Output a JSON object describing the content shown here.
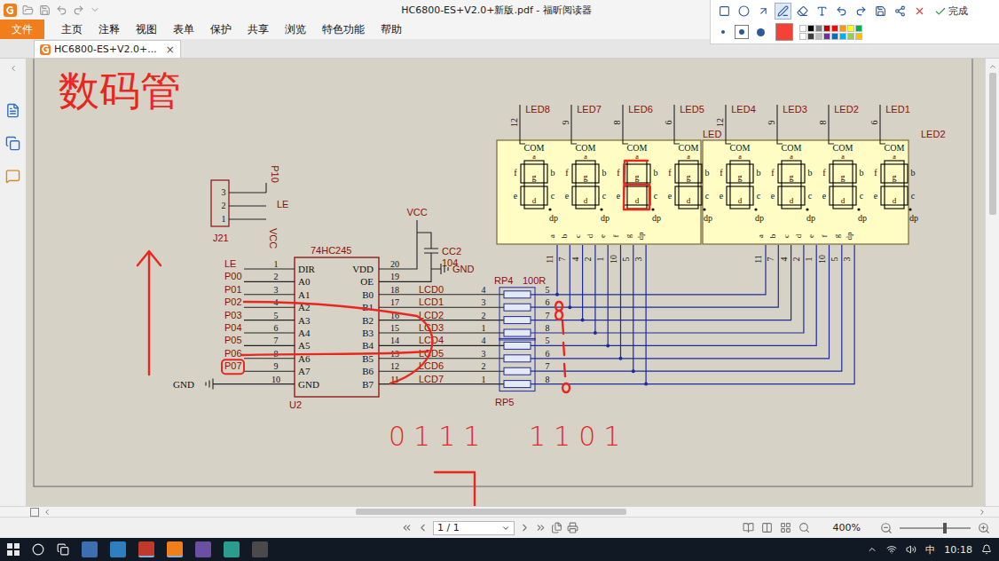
{
  "window": {
    "title": "HC6800-ES+V2.0+新版.pdf - 福昕阅读器"
  },
  "menu": [
    {
      "label": "文件",
      "selected": true
    },
    {
      "label": "主页",
      "selected": false
    },
    {
      "label": "注释",
      "selected": false
    },
    {
      "label": "视图",
      "selected": false
    },
    {
      "label": "表单",
      "selected": false
    },
    {
      "label": "保护",
      "selected": false
    },
    {
      "label": "共享",
      "selected": false
    },
    {
      "label": "浏览",
      "selected": false
    },
    {
      "label": "特色功能",
      "selected": false
    },
    {
      "label": "帮助",
      "selected": false
    }
  ],
  "tabs": [
    {
      "label": "HC6800-ES+V2.0+...",
      "selected": true,
      "close": "×"
    }
  ],
  "annotation_toolbar": {
    "tools": [
      {
        "kind": "rectangle",
        "selected": false
      },
      {
        "kind": "ellipse",
        "selected": false
      },
      {
        "kind": "arrow",
        "selected": false
      },
      {
        "kind": "pen",
        "selected": true
      },
      {
        "kind": "eraser",
        "selected": false
      },
      {
        "kind": "text",
        "selected": false
      },
      {
        "kind": "undo",
        "selected": false
      },
      {
        "kind": "redo",
        "selected": false
      },
      {
        "kind": "save",
        "selected": false
      },
      {
        "kind": "share",
        "selected": false
      },
      {
        "kind": "close",
        "selected": false
      }
    ],
    "done": "完成",
    "pen_sizes": [
      {
        "selected": false
      },
      {
        "selected": true
      },
      {
        "selected": false
      }
    ],
    "current_color": "#f44336",
    "palette": [
      {
        "color": "#ffffff",
        "selected": false
      },
      {
        "color": "#000000",
        "selected": false
      },
      {
        "color": "#7f7f7f",
        "selected": false
      },
      {
        "color": "#c00000",
        "selected": false
      },
      {
        "color": "#ff0000",
        "selected": false
      },
      {
        "color": "#ff9900",
        "selected": false
      },
      {
        "color": "#ffff00",
        "selected": false
      },
      {
        "color": "#00b050",
        "selected": false
      },
      {
        "color": "#ffffff",
        "selected": false
      },
      {
        "color": "#3f3f3f",
        "selected": false
      },
      {
        "color": "#bfbfbf",
        "selected": false
      },
      {
        "color": "#7030a0",
        "selected": false
      },
      {
        "color": "#0070c0",
        "selected": false
      },
      {
        "color": "#00b0f0",
        "selected": false
      },
      {
        "color": "#92d050",
        "selected": false
      },
      {
        "color": "#ffc000",
        "selected": false
      }
    ]
  },
  "schematic": {
    "heading": "数码管",
    "connector": {
      "ref": "J21",
      "pins": [
        {
          "num": "3",
          "net": "P10"
        },
        {
          "num": "2",
          "net": "LE"
        },
        {
          "num": "1",
          "net": "VCC"
        }
      ]
    },
    "chip": {
      "part": "74HC245",
      "ref": "U2",
      "left": [
        {
          "net": "LE",
          "num": "1",
          "name": "DIR",
          "kind": "signal",
          "marked": false
        },
        {
          "net": "P00",
          "num": "2",
          "name": "A0",
          "kind": "signal",
          "marked": false
        },
        {
          "net": "P01",
          "num": "3",
          "name": "A1",
          "kind": "signal",
          "marked": false
        },
        {
          "net": "P02",
          "num": "4",
          "name": "A2",
          "kind": "signal",
          "marked": false
        },
        {
          "net": "P03",
          "num": "5",
          "name": "A3",
          "kind": "signal",
          "marked": false
        },
        {
          "net": "P04",
          "num": "6",
          "name": "A4",
          "kind": "signal",
          "marked": false
        },
        {
          "net": "P05",
          "num": "7",
          "name": "A5",
          "kind": "signal",
          "marked": false
        },
        {
          "net": "P06",
          "num": "8",
          "name": "A6",
          "kind": "signal",
          "marked": false
        },
        {
          "net": "P07",
          "num": "9",
          "name": "A7",
          "kind": "signal",
          "marked": true
        },
        {
          "net": "GND",
          "num": "10",
          "name": "GND",
          "kind": "ground",
          "marked": false
        }
      ],
      "right": [
        {
          "name": "VDD",
          "num": "20",
          "net": "VCC",
          "kind": "supply"
        },
        {
          "name": "OE",
          "num": "19",
          "net": "GND",
          "kind": "ground"
        },
        {
          "name": "B0",
          "num": "18",
          "net": "LCD0",
          "kind": "bus"
        },
        {
          "name": "B1",
          "num": "17",
          "net": "LCD1",
          "kind": "bus"
        },
        {
          "name": "B2",
          "num": "16",
          "net": "LCD2",
          "kind": "bus"
        },
        {
          "name": "B3",
          "num": "15",
          "net": "LCD3",
          "kind": "bus"
        },
        {
          "name": "B4",
          "num": "14",
          "net": "LCD4",
          "kind": "bus"
        },
        {
          "name": "B5",
          "num": "13",
          "net": "LCD5",
          "kind": "bus"
        },
        {
          "name": "B6",
          "num": "12",
          "net": "LCD6",
          "kind": "bus"
        },
        {
          "name": "B7",
          "num": "11",
          "net": "LCD7",
          "kind": "bus"
        }
      ]
    },
    "capacitor": {
      "ref": "CC2",
      "value": "104"
    },
    "resistors": {
      "upper": "RP4",
      "lower": "RP5",
      "value": "100R",
      "left_pins": [
        "4",
        "3",
        "2",
        "1",
        "4",
        "3",
        "2",
        "1"
      ],
      "right_pins": [
        "5",
        "6",
        "7",
        "8",
        "5",
        "6",
        "7",
        "8"
      ]
    },
    "digit_labels": {
      "com": "COM",
      "a": "a",
      "b": "b",
      "c": "c",
      "d": "d",
      "e": "e",
      "f": "f",
      "g": "g",
      "dp": "dp"
    },
    "displays": [
      {
        "digits": [
          {
            "label": "LED8",
            "pin": "12",
            "marked": false
          },
          {
            "label": "LED7",
            "pin": "9",
            "marked": false
          },
          {
            "label": "LED6",
            "pin": "8",
            "marked": true
          },
          {
            "label": "LED5",
            "pin": "6",
            "marked": false
          }
        ],
        "segment_pins": [
          {
            "seg": "a",
            "num": "11"
          },
          {
            "seg": "b",
            "num": "7"
          },
          {
            "seg": "c",
            "num": "4"
          },
          {
            "seg": "d",
            "num": "2"
          },
          {
            "seg": "e",
            "num": "1"
          },
          {
            "seg": "f",
            "num": "10"
          },
          {
            "seg": "g",
            "num": "5"
          },
          {
            "seg": "dp",
            "num": "3"
          }
        ]
      },
      {
        "digits": [
          {
            "label": "LED4",
            "pin": "12",
            "marked": false
          },
          {
            "label": "LED3",
            "pin": "9",
            "marked": false
          },
          {
            "label": "LED2",
            "pin": "8",
            "marked": false
          },
          {
            "label": "LED1",
            "pin": "6",
            "marked": false
          }
        ],
        "segment_pins": [
          {
            "seg": "a",
            "num": "11"
          },
          {
            "seg": "b",
            "num": "7"
          },
          {
            "seg": "c",
            "num": "4"
          },
          {
            "seg": "d",
            "num": "2"
          },
          {
            "seg": "e",
            "num": "1"
          },
          {
            "seg": "f",
            "num": "10"
          },
          {
            "seg": "g",
            "num": "5"
          },
          {
            "seg": "dp",
            "num": "3"
          }
        ]
      }
    ],
    "net_labels": [
      "LED",
      "LED2"
    ],
    "handwriting": [
      "0111",
      "1101"
    ]
  },
  "status_bar": {
    "page": "1 / 1",
    "zoom": "400%",
    "zoom_level": 0.65
  },
  "taskbar": {
    "ime": "中",
    "time": "10:18"
  }
}
